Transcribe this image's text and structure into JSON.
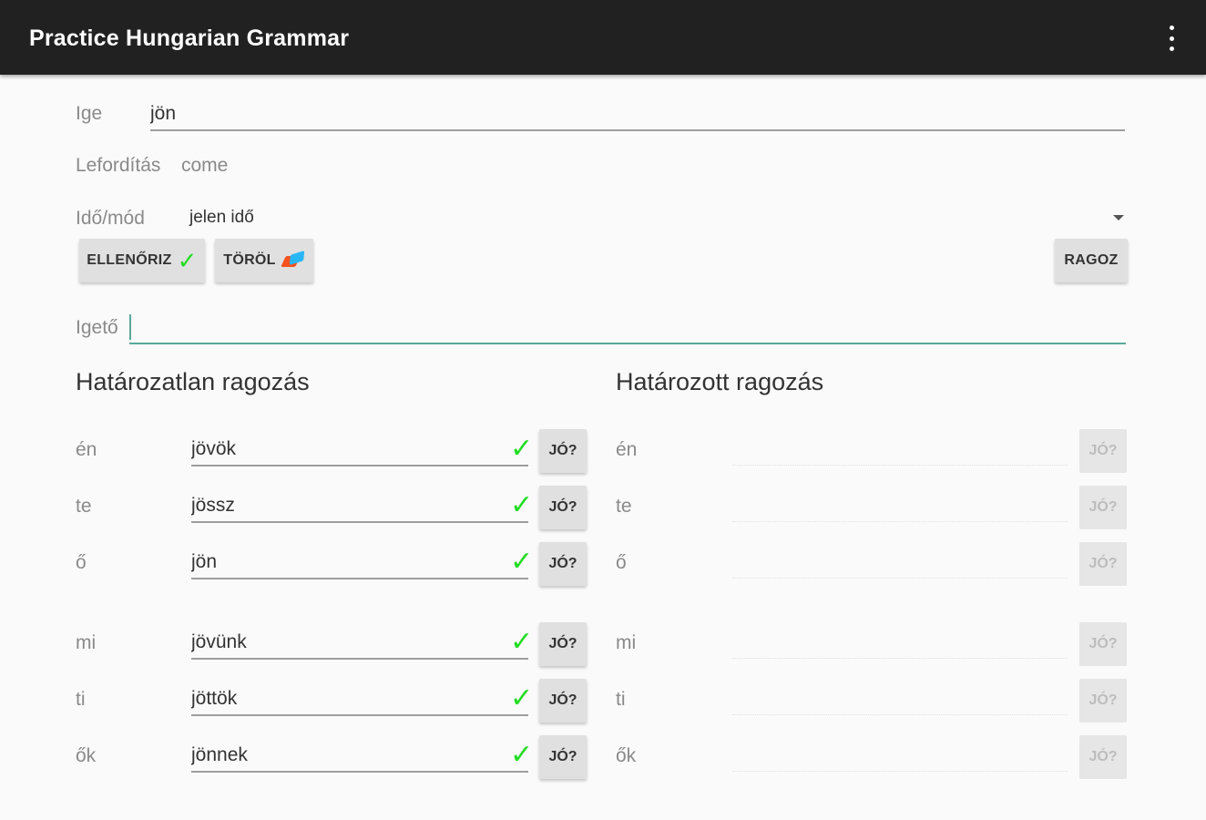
{
  "app_bar": {
    "title": "Practice Hungarian Grammar",
    "menu_icon": "more-vert-icon"
  },
  "form": {
    "verb_label": "Ige",
    "verb_value": "jön",
    "translation_label": "Lefordítás",
    "translation_value": "come",
    "tense_label": "Idő/mód",
    "tense_value": "jelen idő",
    "stem_label": "Igető",
    "stem_value": ""
  },
  "buttons": {
    "check": "ELLENŐRIZ",
    "check_icon": "check-mark-icon",
    "clear": "TÖRÖL",
    "clear_icon": "eraser-icon",
    "conjugate": "RAGOZ"
  },
  "colors": {
    "check_green": "#22dd22",
    "stem_accent": "#5aa89a",
    "app_bar": "#212121"
  },
  "indefinite": {
    "title": "Határozatlan ragozás",
    "rows": [
      {
        "pronoun": "én",
        "value": "jövök",
        "button": "JÓ?"
      },
      {
        "pronoun": "te",
        "value": "jössz",
        "button": "JÓ?"
      },
      {
        "pronoun": "ő",
        "value": "jön",
        "button": "JÓ?"
      },
      {
        "pronoun": "mi",
        "value": "jövünk",
        "button": "JÓ?"
      },
      {
        "pronoun": "ti",
        "value": "jöttök",
        "button": "JÓ?"
      },
      {
        "pronoun": "ők",
        "value": "jönnek",
        "button": "JÓ?"
      }
    ]
  },
  "definite": {
    "title": "Határozott ragozás",
    "rows": [
      {
        "pronoun": "én",
        "value": "",
        "button": "JÓ?"
      },
      {
        "pronoun": "te",
        "value": "",
        "button": "JÓ?"
      },
      {
        "pronoun": "ő",
        "value": "",
        "button": "JÓ?"
      },
      {
        "pronoun": "mi",
        "value": "",
        "button": "JÓ?"
      },
      {
        "pronoun": "ti",
        "value": "",
        "button": "JÓ?"
      },
      {
        "pronoun": "ők",
        "value": "",
        "button": "JÓ?"
      }
    ]
  }
}
